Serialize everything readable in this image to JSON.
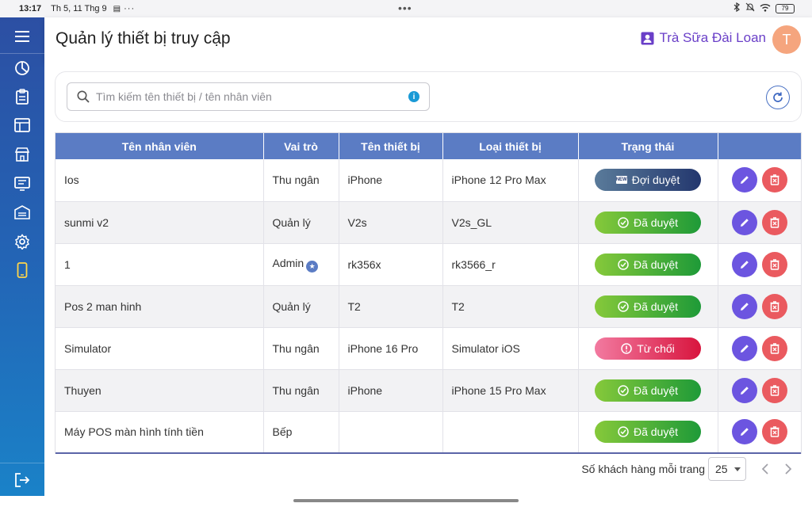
{
  "status_bar": {
    "time": "13:17",
    "date": "Th 5, 11 Thg 9",
    "more": "···",
    "battery": "79"
  },
  "header": {
    "title": "Quản lý thiết bị truy cập",
    "store_name": "Trà Sữa Đài Loan",
    "avatar_initial": "T"
  },
  "sidebar": {
    "items": [
      {
        "icon": "dashboard-icon"
      },
      {
        "icon": "clipboard-icon"
      },
      {
        "icon": "layout-icon"
      },
      {
        "icon": "store-icon"
      },
      {
        "icon": "receipt-icon"
      },
      {
        "icon": "warehouse-icon"
      },
      {
        "icon": "settings-icon"
      },
      {
        "icon": "device-icon",
        "active": true
      }
    ]
  },
  "search": {
    "placeholder": "Tìm kiếm tên thiết bị / tên nhân viên",
    "value": ""
  },
  "table": {
    "headers": [
      "Tên nhân viên",
      "Vai trò",
      "Tên thiết bị",
      "Loại thiết bị",
      "Trạng thái",
      ""
    ],
    "rows": [
      {
        "employee": "Ios",
        "role": "Thu ngân",
        "device_name": "iPhone",
        "device_type": "iPhone 12 Pro Max",
        "status": "Đợi duyệt",
        "status_kind": "pending"
      },
      {
        "employee": "sunmi v2",
        "role": "Quản lý",
        "device_name": "V2s",
        "device_type": "V2s_GL",
        "status": "Đã duyệt",
        "status_kind": "approved"
      },
      {
        "employee": "1",
        "role": "Admin",
        "device_name": "rk356x",
        "device_type": "rk3566_r",
        "status": "Đã duyệt",
        "status_kind": "approved"
      },
      {
        "employee": "Pos 2 man hinh",
        "role": "Quản lý",
        "device_name": "T2",
        "device_type": "T2",
        "status": "Đã duyệt",
        "status_kind": "approved"
      },
      {
        "employee": "Simulator",
        "role": "Thu ngân",
        "device_name": "iPhone 16 Pro",
        "device_type": "Simulator iOS",
        "status": "Từ chối",
        "status_kind": "rejected"
      },
      {
        "employee": "Thuyen",
        "role": "Thu ngân",
        "device_name": "iPhone",
        "device_type": "iPhone 15 Pro Max",
        "status": "Đã duyệt",
        "status_kind": "approved"
      },
      {
        "employee": "Máy POS màn hình tính tiền",
        "role": "Bếp",
        "device_name": "",
        "device_type": "",
        "status": "Đã duyệt",
        "status_kind": "approved"
      }
    ]
  },
  "pagination": {
    "per_page_label": "Số khách hàng mỗi trang",
    "per_page_value": "25"
  },
  "colors": {
    "sidebar_top": "#2c4fa3",
    "sidebar_bottom": "#1a82c8",
    "header_accent": "#6a3fc8",
    "table_header": "#5b7cc4",
    "edit_button": "#6c55e0",
    "delete_button": "#ea5a5f"
  }
}
